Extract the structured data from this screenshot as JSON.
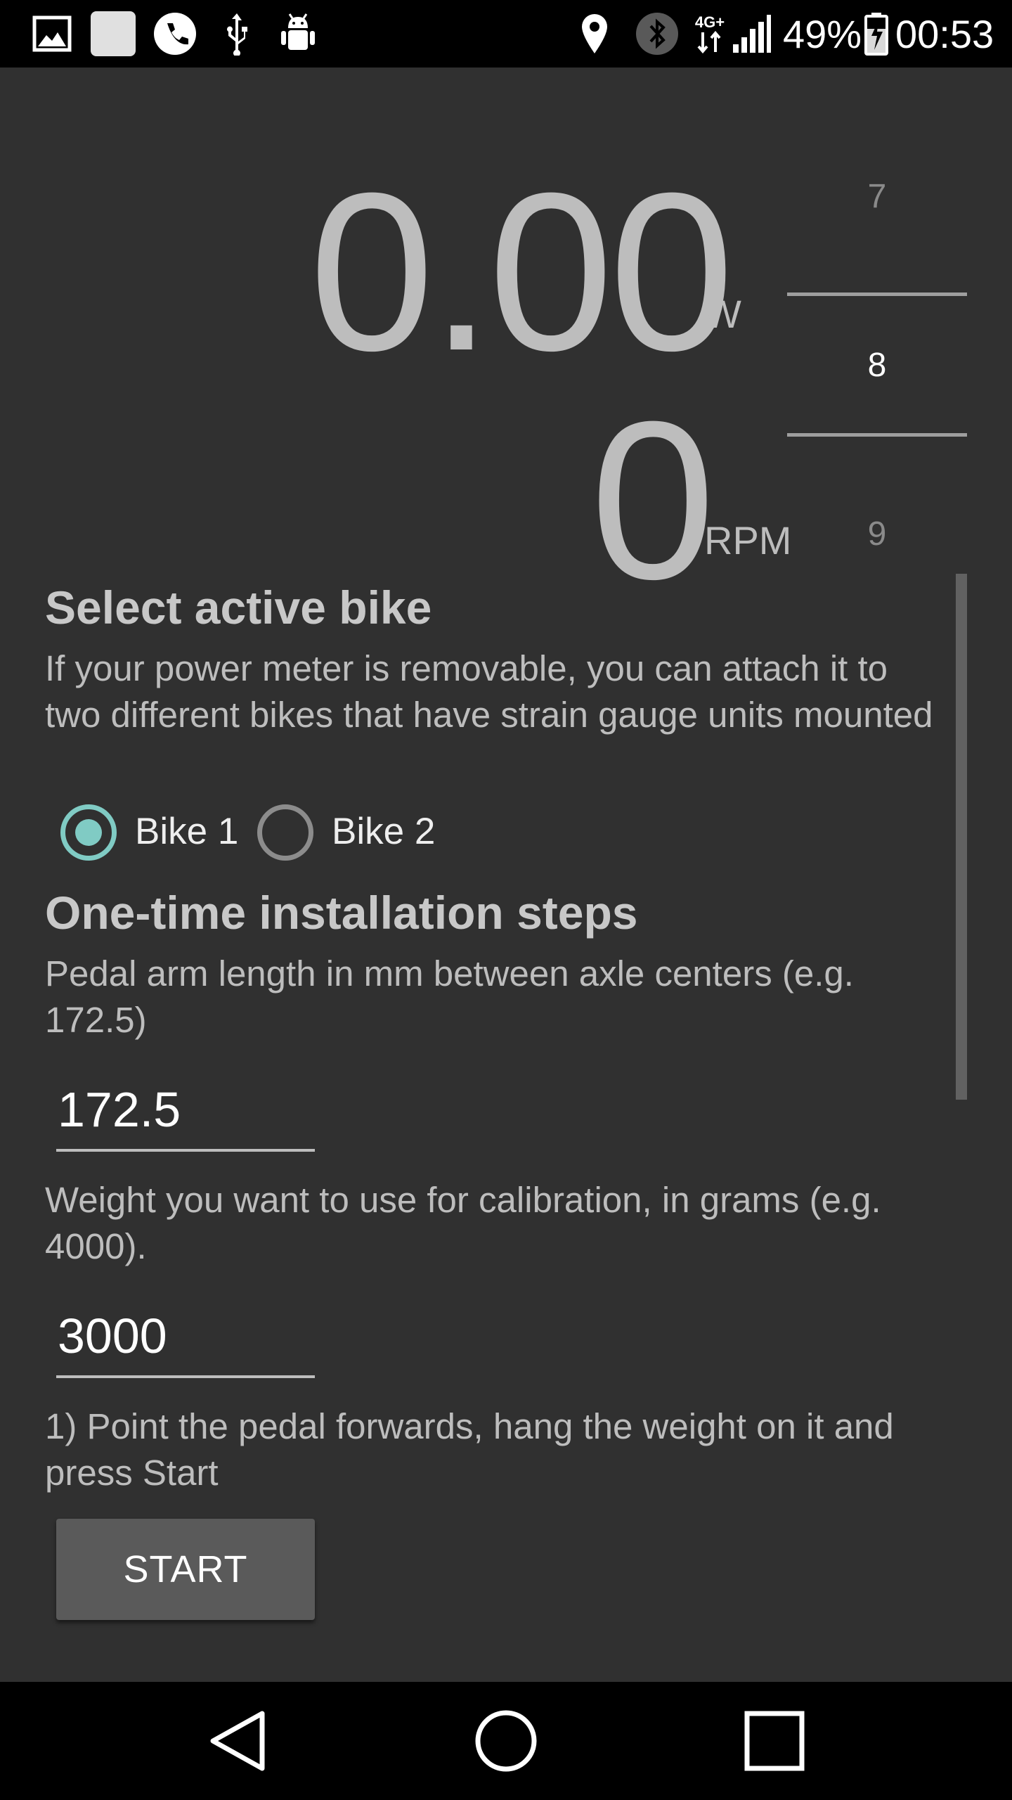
{
  "status_bar": {
    "battery_percent": "49%",
    "time": "00:53",
    "network_type": "4G+",
    "icons": [
      "gallery-icon",
      "app-icon",
      "phone-icon",
      "usb-icon",
      "android-debug-icon",
      "location-icon",
      "bluetooth-icon",
      "network-4g-icon",
      "signal-icon",
      "battery-charging-icon"
    ]
  },
  "meter": {
    "power_value": "0.00",
    "power_unit": "W",
    "cadence_value": "0",
    "cadence_unit": "RPM"
  },
  "picker": {
    "prev": "7",
    "selected": "8",
    "next": "9"
  },
  "bike_section": {
    "title": "Select active bike",
    "description": "If your power meter is removable, you can attach it to two different bikes that have strain gauge units mounted",
    "options": [
      {
        "label": "Bike 1",
        "checked": true
      },
      {
        "label": "Bike 2",
        "checked": false
      }
    ]
  },
  "install_section": {
    "title": "One-time installation steps",
    "arm_length_label": "Pedal arm length in mm between axle centers (e.g. 172.5)",
    "arm_length_value": "172.5",
    "weight_label": "Weight you want to use for calibration, in grams (e.g. 4000).",
    "weight_value": "3000",
    "step1_text": "1) Point the pedal forwards, hang the weight on it and press Start",
    "start_button": "START"
  },
  "nav_bar": {
    "buttons": [
      "back",
      "home",
      "recents"
    ]
  },
  "colors": {
    "background": "#303030",
    "accent": "#80cbc4",
    "text_primary": "#bdbdbd",
    "button": "#5a5a5a"
  }
}
